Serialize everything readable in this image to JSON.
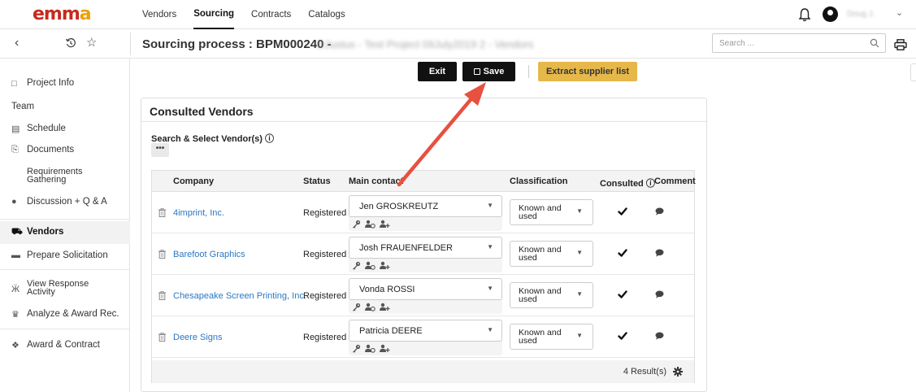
{
  "logo": {
    "text_main": "emm",
    "text_accent": "a"
  },
  "topnav": {
    "items": [
      "Vendors",
      "Sourcing",
      "Contracts",
      "Catalogs"
    ],
    "active": "Sourcing"
  },
  "user": {
    "name": "Doug J."
  },
  "header": {
    "title": "Sourcing process : BPM000240 -",
    "title_obscured": "DJustus - Test Project 09July2019 2 - Vendors",
    "search_placeholder": "Search ..."
  },
  "sidebar": {
    "items": [
      {
        "label": "Project Info"
      },
      {
        "label": "Team"
      },
      {
        "label": "Schedule"
      },
      {
        "label": "Documents"
      },
      {
        "label": "Requirements Gathering"
      },
      {
        "label": "Discussion + Q & A"
      },
      {
        "label": "Vendors"
      },
      {
        "label": "Prepare Solicitation"
      },
      {
        "label": "View Response Activity"
      },
      {
        "label": "Analyze & Award Rec."
      },
      {
        "label": "Award & Contract"
      }
    ],
    "active": "Vendors"
  },
  "actions": {
    "exit": "Exit",
    "save": "Save",
    "extract": "Extract supplier list"
  },
  "card": {
    "title": "Consulted Vendors",
    "search_label": "Search & Select Vendor(s) ⓘ",
    "dots": "•••"
  },
  "table": {
    "columns": [
      "Company",
      "Status",
      "Main contact",
      "Classification",
      "Consulted ⓘ",
      "Comment"
    ],
    "rows": [
      {
        "company": "4imprint, Inc.",
        "status": "Registered",
        "contact": "Jen GROSKREUTZ",
        "classification": "Known and used",
        "consulted": true
      },
      {
        "company": "Barefoot Graphics",
        "status": "Registered",
        "contact": "Josh FRAUENFELDER",
        "classification": "Known and used",
        "consulted": true
      },
      {
        "company": "Chesapeake Screen Printing, Inc.",
        "status": "Registered",
        "contact": "Vonda ROSSI",
        "classification": "Known and used",
        "consulted": true
      },
      {
        "company": "Deere Signs",
        "status": "Registered",
        "contact": "Patricia DEERE",
        "classification": "Known and used",
        "consulted": true
      }
    ],
    "results": "4 Result(s)"
  },
  "colors": {
    "brand_red": "#c62a1f",
    "brand_orange": "#f0a000",
    "extract_button": "#e6b84a",
    "link_blue": "#2a78c4",
    "annotation_arrow": "#e8503f"
  },
  "icons": {
    "topbar": [
      "bell-icon",
      "user-avatar-icon",
      "chevron-down-icon"
    ],
    "subbar": [
      "back-icon",
      "history-icon",
      "star-icon",
      "search-icon",
      "print-icon"
    ],
    "row": [
      "trash-icon",
      "key-icon",
      "contacts-icon",
      "add-contact-icon",
      "checkbox-checked-icon",
      "comment-icon"
    ]
  }
}
